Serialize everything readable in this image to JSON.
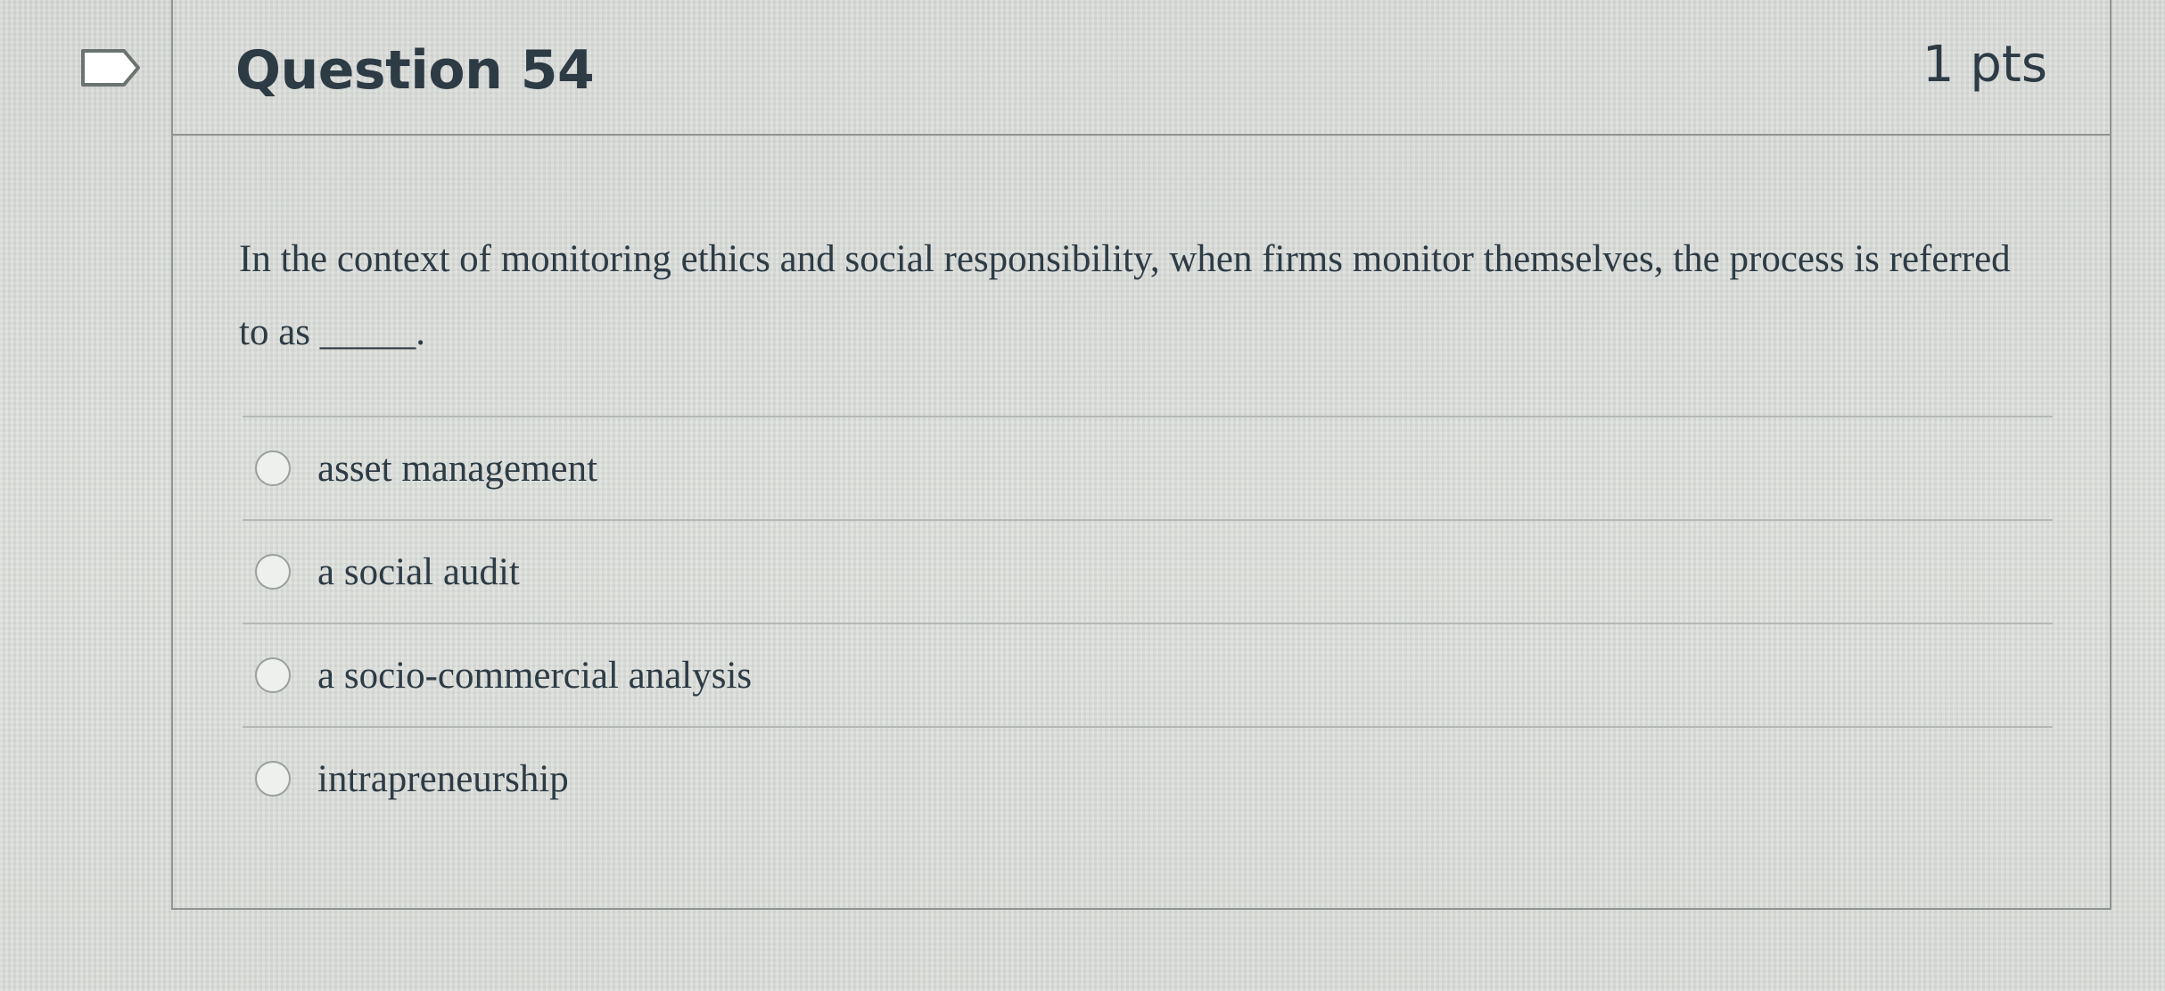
{
  "question": {
    "title": "Question 54",
    "points": "1 pts",
    "text": "In the context of monitoring ethics and social responsibility, when firms monitor themselves, the process is referred to as _____.",
    "flag_icon": "flag-outline-icon"
  },
  "answers": [
    {
      "label": "asset management"
    },
    {
      "label": "a social audit"
    },
    {
      "label": "a socio-commercial analysis"
    },
    {
      "label": "intrapreneurship"
    }
  ],
  "colors": {
    "text": "#2d3b45",
    "border": "#8f9391"
  }
}
